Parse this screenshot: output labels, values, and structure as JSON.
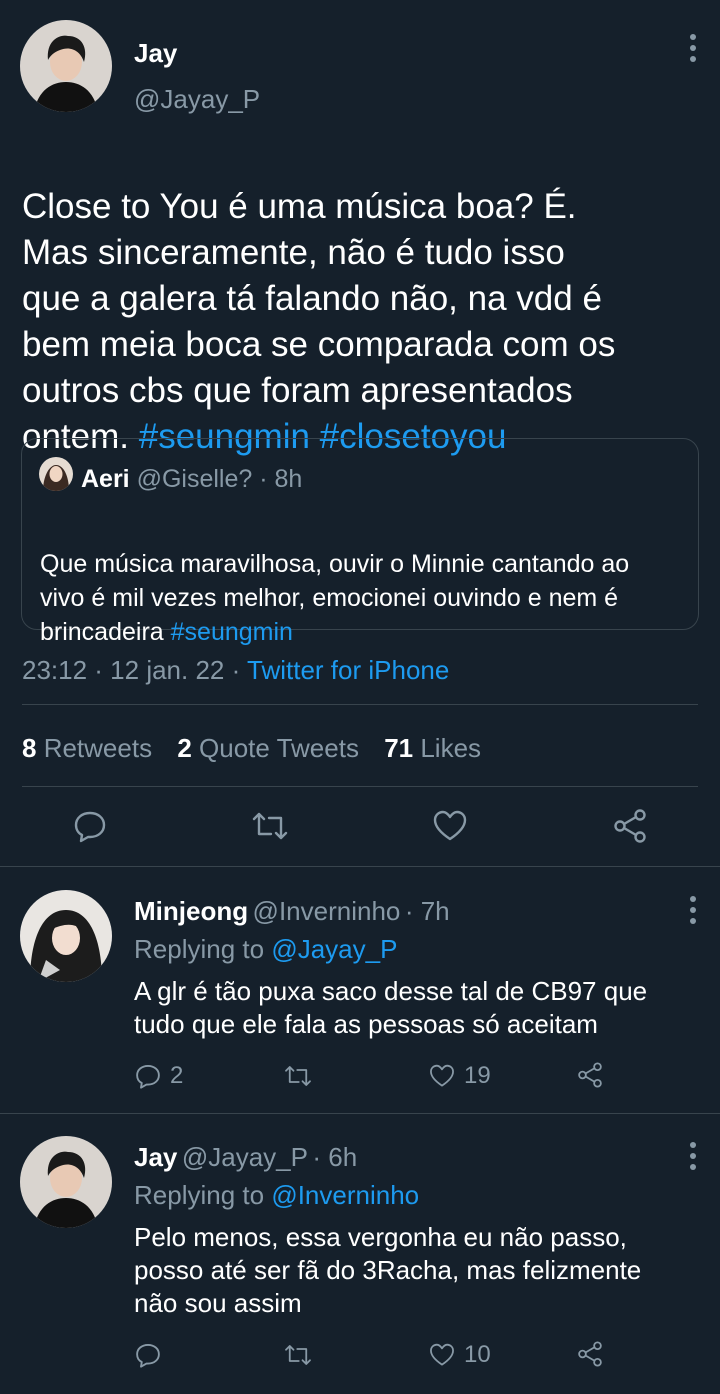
{
  "main_tweet": {
    "author_name": "Jay",
    "author_handle": "@Jayay_P",
    "text_plain": "Close to You é uma música boa? É.\nMas sinceramente, não é tudo isso\nque a galera tá falando não, na vdd é\nbem meia boca se comparada com os\noutros cbs que foram apresentados\nontem. ",
    "hashtags": "#seungmin #closetoyou",
    "quote": {
      "author_name": "Aeri",
      "author_handle": "@Giselle?",
      "time": "· 8h",
      "text_plain": "Que música maravilhosa, ouvir o Minnie cantando ao\nvivo é mil vezes melhor, emocionei ouvindo e nem é\nbrincadeira ",
      "hashtag": "#seungmin"
    },
    "timestamp": "23:12 · 12 jan. 22 · ",
    "source": "Twitter for iPhone",
    "stats": {
      "retweets_count": "8",
      "retweets_label": " Retweets",
      "quotes_count": "2",
      "quotes_label": " Quote Tweets",
      "likes_count": "71",
      "likes_label": " Likes"
    },
    "actions": [
      "reply-icon",
      "retweet-icon",
      "like-icon",
      "share-icon"
    ]
  },
  "replies": [
    {
      "author_name": "Minjeong",
      "author_handle": "@Inverninho",
      "time": "· 7h",
      "replying_prefix": "Replying to ",
      "replying_handle": "@Jayay_P",
      "text": "A glr é tão puxa saco desse tal de CB97 que\ntudo que ele fala as pessoas só aceitam",
      "reply_count": "2",
      "retweet_count": "",
      "like_count": "19"
    },
    {
      "author_name": "Jay",
      "author_handle": "@Jayay_P",
      "time": "· 6h",
      "replying_prefix": "Replying to ",
      "replying_handle": "@Inverninho",
      "text": "Pelo menos, essa vergonha eu não passo,\nposso até ser fã do 3Racha, mas felizmente\nnão sou assim",
      "reply_count": "",
      "retweet_count": "",
      "like_count": "10"
    }
  ],
  "colors": {
    "background": "#15202b",
    "link": "#1d9bf0",
    "muted": "#8899a6",
    "border": "#38444d"
  }
}
